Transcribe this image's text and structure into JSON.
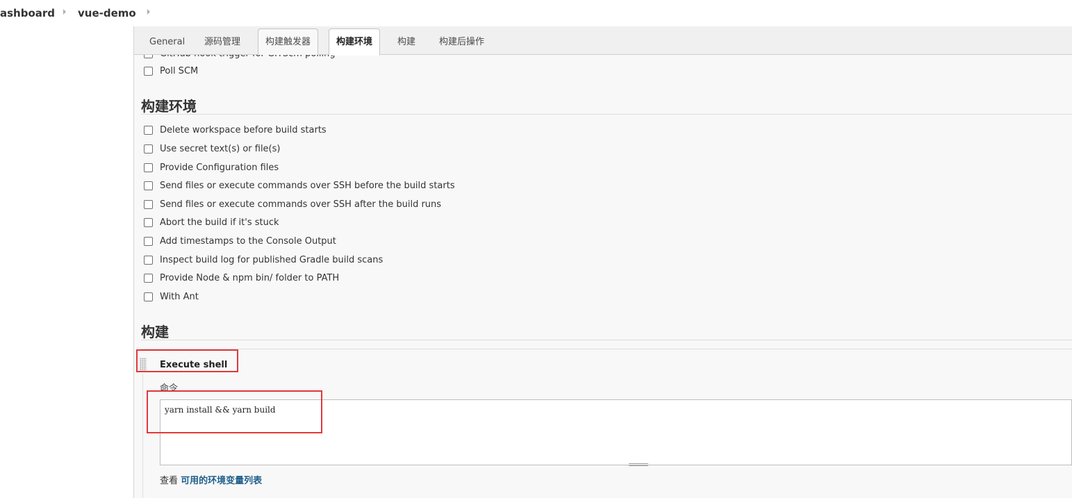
{
  "breadcrumb": {
    "items": [
      "ashboard",
      "vue-demo"
    ]
  },
  "tabs": [
    {
      "label": "General"
    },
    {
      "label": "源码管理"
    },
    {
      "label": "构建触发器"
    },
    {
      "label": "构建环境"
    },
    {
      "label": "构建"
    },
    {
      "label": "构建后操作"
    }
  ],
  "triggers": {
    "cut_option": "GitHub hook trigger for GITScm polling",
    "poll_scm": "Poll SCM"
  },
  "build_env": {
    "title": "构建环境",
    "options": [
      "Delete workspace before build starts",
      "Use secret text(s) or file(s)",
      "Provide Configuration files",
      "Send files or execute commands over SSH before the build starts",
      "Send files or execute commands over SSH after the build runs",
      "Abort the build if it's stuck",
      "Add timestamps to the Console Output",
      "Inspect build log for published Gradle build scans",
      "Provide Node & npm bin/ folder to PATH",
      "With Ant"
    ]
  },
  "build": {
    "title": "构建",
    "step_title": "Execute shell",
    "command_label": "命令",
    "command_value": "yarn install && yarn build",
    "help_prefix": "查看",
    "help_link": "可用的环境变量列表"
  },
  "colors": {
    "highlight": "#e0383b",
    "link": "#1f5f8b"
  }
}
